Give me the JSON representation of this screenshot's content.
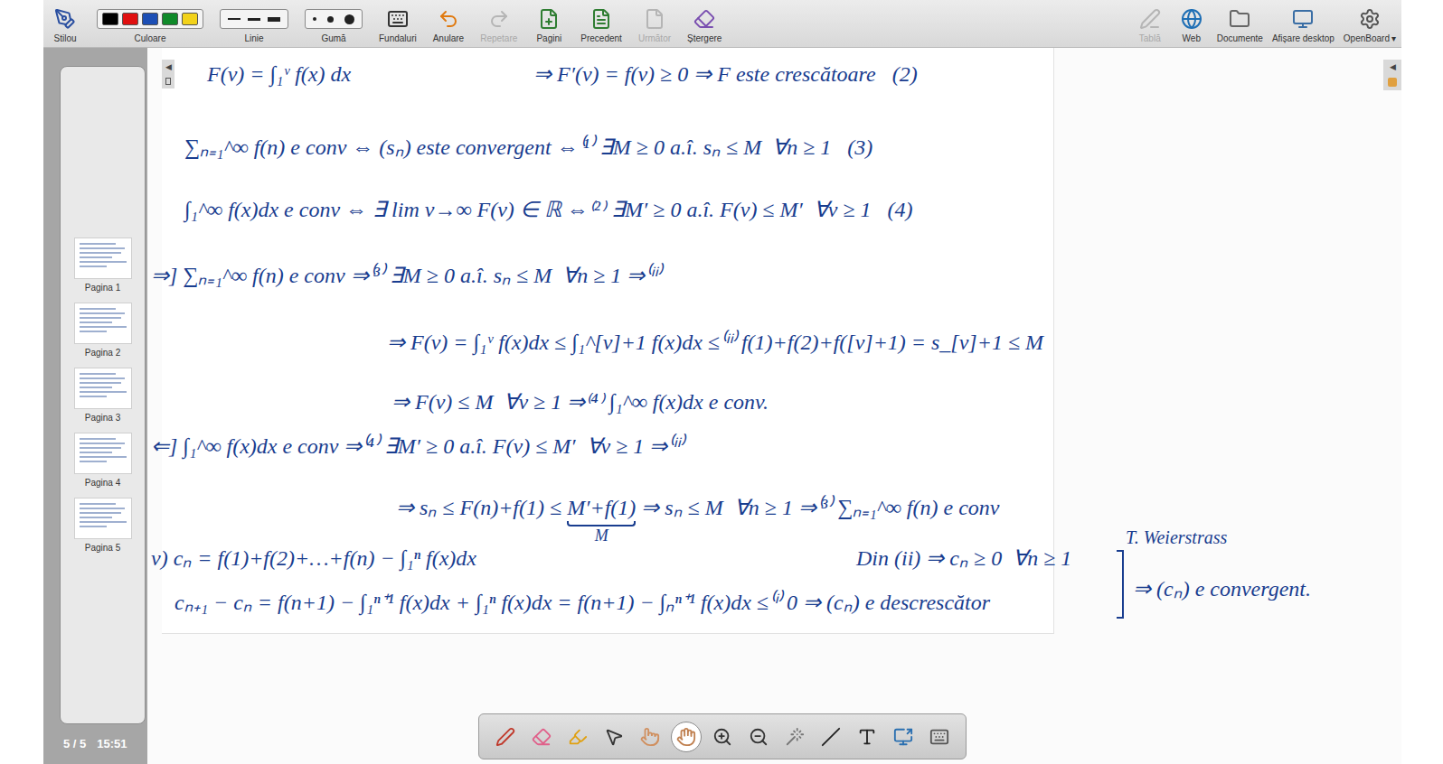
{
  "toolbar": {
    "left": [
      {
        "label": "Stilou",
        "kind": "button",
        "disabled": false
      },
      {
        "label": "Culoare",
        "kind": "colors",
        "disabled": false,
        "colors": [
          "#000000",
          "#e01010",
          "#1d4fb5",
          "#108a2a",
          "#f2d21a"
        ]
      },
      {
        "label": "Linie",
        "kind": "lines",
        "disabled": false
      },
      {
        "label": "Gumă",
        "kind": "eraser",
        "disabled": false
      },
      {
        "label": "Fundaluri",
        "kind": "button",
        "disabled": false
      },
      {
        "label": "Anulare",
        "kind": "button",
        "disabled": false
      },
      {
        "label": "Repetare",
        "kind": "button",
        "disabled": true
      },
      {
        "label": "Pagini",
        "kind": "button",
        "disabled": false
      },
      {
        "label": "Precedent",
        "kind": "button",
        "disabled": false
      },
      {
        "label": "Următor",
        "kind": "button",
        "disabled": true
      },
      {
        "label": "Ștergere",
        "kind": "button",
        "disabled": false
      }
    ],
    "right": [
      {
        "label": "Tablă",
        "disabled": true,
        "suffix": ""
      },
      {
        "label": "Web",
        "disabled": false,
        "suffix": ""
      },
      {
        "label": "Documente",
        "disabled": false,
        "suffix": ""
      },
      {
        "label": "Afișare desktop",
        "disabled": false,
        "suffix": ""
      },
      {
        "label": "OpenBoard",
        "disabled": false,
        "suffix": "▾"
      }
    ]
  },
  "sidebar": {
    "pages": [
      {
        "label": "Pagina 1"
      },
      {
        "label": "Pagina 2"
      },
      {
        "label": "Pagina 3"
      },
      {
        "label": "Pagina 4"
      },
      {
        "label": "Pagina 5"
      }
    ],
    "page_counter": "5 / 5",
    "clock": "15:51"
  },
  "side_tabs": [
    "◀",
    "◀"
  ],
  "canvas": {
    "items": [
      {
        "kind": "line",
        "parts": [
          {
            "text": "F(v) = ∫₁ᵛ f(x) dx"
          }
        ]
      },
      {
        "kind": "line",
        "parts": [
          {
            "text": "⇒ F′(v) = f(v) ≥ 0 ⇒ F este crescătoare   (2)"
          }
        ]
      },
      {
        "kind": "line",
        "parts": [
          {
            "text": "∑ₙ₌₁^∞ f(n) e conv ⇔ (sₙ) este convergent ⇔⁽¹⁾ ∃M ≥ 0 a.î. sₙ ≤ M  ∀n ≥ 1   (3)"
          }
        ]
      },
      {
        "kind": "line",
        "parts": [
          {
            "text": "∫₁^∞ f(x)dx e conv ⇔ ∃ lim v→∞ F(v) ∈ ℝ ⇔⁽²⁾ ∃M′ ≥ 0 a.î. F(v) ≤ M′  ∀v ≥ 1   (4)"
          }
        ]
      },
      {
        "kind": "line",
        "parts": [
          {
            "text": "⇒] ∑ₙ₌₁^∞ f(n) e conv ⇒⁽³⁾ ∃M ≥ 0 a.î. sₙ ≤ M  ∀n ≥ 1 ⇒⁽ⁱⁱ⁾"
          }
        ]
      },
      {
        "kind": "line",
        "parts": [
          {
            "text": "⇒ F(v) = ∫₁ᵛ f(x)dx ≤ ∫₁^[v]+1 f(x)dx ≤⁽ⁱⁱ⁾ f(1)+f(2)+f([v]+1) = s_[v]+1 ≤ M"
          }
        ]
      },
      {
        "kind": "line",
        "parts": [
          {
            "text": "⇒ F(v) ≤ M  ∀v ≥ 1 ⇒⁽⁴⁾ ∫₁^∞ f(x)dx e conv."
          }
        ]
      },
      {
        "kind": "line",
        "parts": [
          {
            "text": "⇐] ∫₁^∞ f(x)dx e conv ⇒⁽⁴⁾ ∃M′ ≥ 0 a.î. F(v) ≤ M′  ∀v ≥ 1 ⇒⁽ⁱⁱ⁾"
          }
        ]
      },
      {
        "kind": "line",
        "parts": [
          {
            "text": "⇒ sₙ ≤ F(n)+f(1) ≤ "
          },
          {
            "text": "M′+f(1)",
            "under": "M"
          },
          {
            "text": " ⇒ sₙ ≤ M  ∀n ≥ 1 ⇒⁽³⁾ ∑ₙ₌₁^∞ f(n) e conv"
          }
        ]
      },
      {
        "kind": "line",
        "parts": [
          {
            "text": "v) cₙ = f(1)+f(2)+…+f(n) − ∫₁ⁿ f(x)dx"
          }
        ]
      },
      {
        "kind": "line",
        "parts": [
          {
            "text": "Din (ii) ⇒ cₙ ≥ 0  ∀n ≥ 1"
          }
        ]
      },
      {
        "kind": "note",
        "parts": [
          {
            "text": "T. Weierstrass"
          }
        ]
      },
      {
        "kind": "line",
        "parts": [
          {
            "text": "cₙ₊₁ − cₙ = f(n+1) − ∫₁ⁿ⁺¹ f(x)dx + ∫₁ⁿ f(x)dx = f(n+1) − ∫ₙⁿ⁺¹ f(x)dx ≤⁽ⁱ⁾ 0 ⇒ (cₙ) e descrescător"
          }
        ]
      },
      {
        "kind": "line",
        "parts": [
          {
            "text": "⇒ (cₙ) e convergent."
          }
        ]
      }
    ]
  },
  "bottom_tools": [
    {
      "selected": false
    },
    {
      "selected": false
    },
    {
      "selected": false
    },
    {
      "selected": false
    },
    {
      "selected": false
    },
    {
      "selected": true
    },
    {
      "selected": false
    },
    {
      "selected": false
    },
    {
      "selected": false
    },
    {
      "selected": false
    },
    {
      "selected": false
    },
    {
      "selected": false
    },
    {
      "selected": false
    }
  ]
}
